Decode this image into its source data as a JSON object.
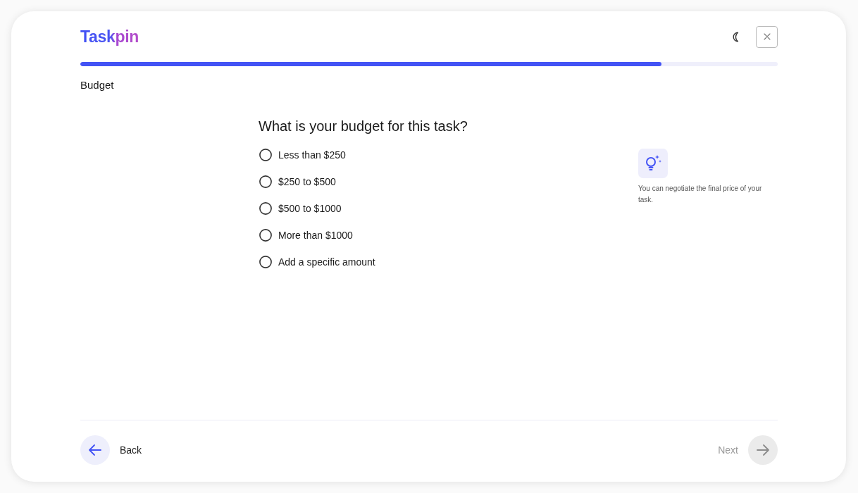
{
  "logo": "Taskpin",
  "progress": {
    "level": 0.833
  },
  "step_title": "Budget",
  "question": "What is your budget for this task?",
  "options": [
    {
      "label": "Less than $250",
      "selected": false
    },
    {
      "label": "$250 to $500",
      "selected": false
    },
    {
      "label": "$500 to $1000",
      "selected": false
    },
    {
      "label": "More than $1000",
      "selected": false
    },
    {
      "label": "Add a specific amount",
      "selected": false
    }
  ],
  "tip": {
    "text": "You can negotiate the final price of your task."
  },
  "footer": {
    "back": {
      "label": "Back",
      "disabled": false
    },
    "next": {
      "label": "Next",
      "disabled": true
    }
  }
}
